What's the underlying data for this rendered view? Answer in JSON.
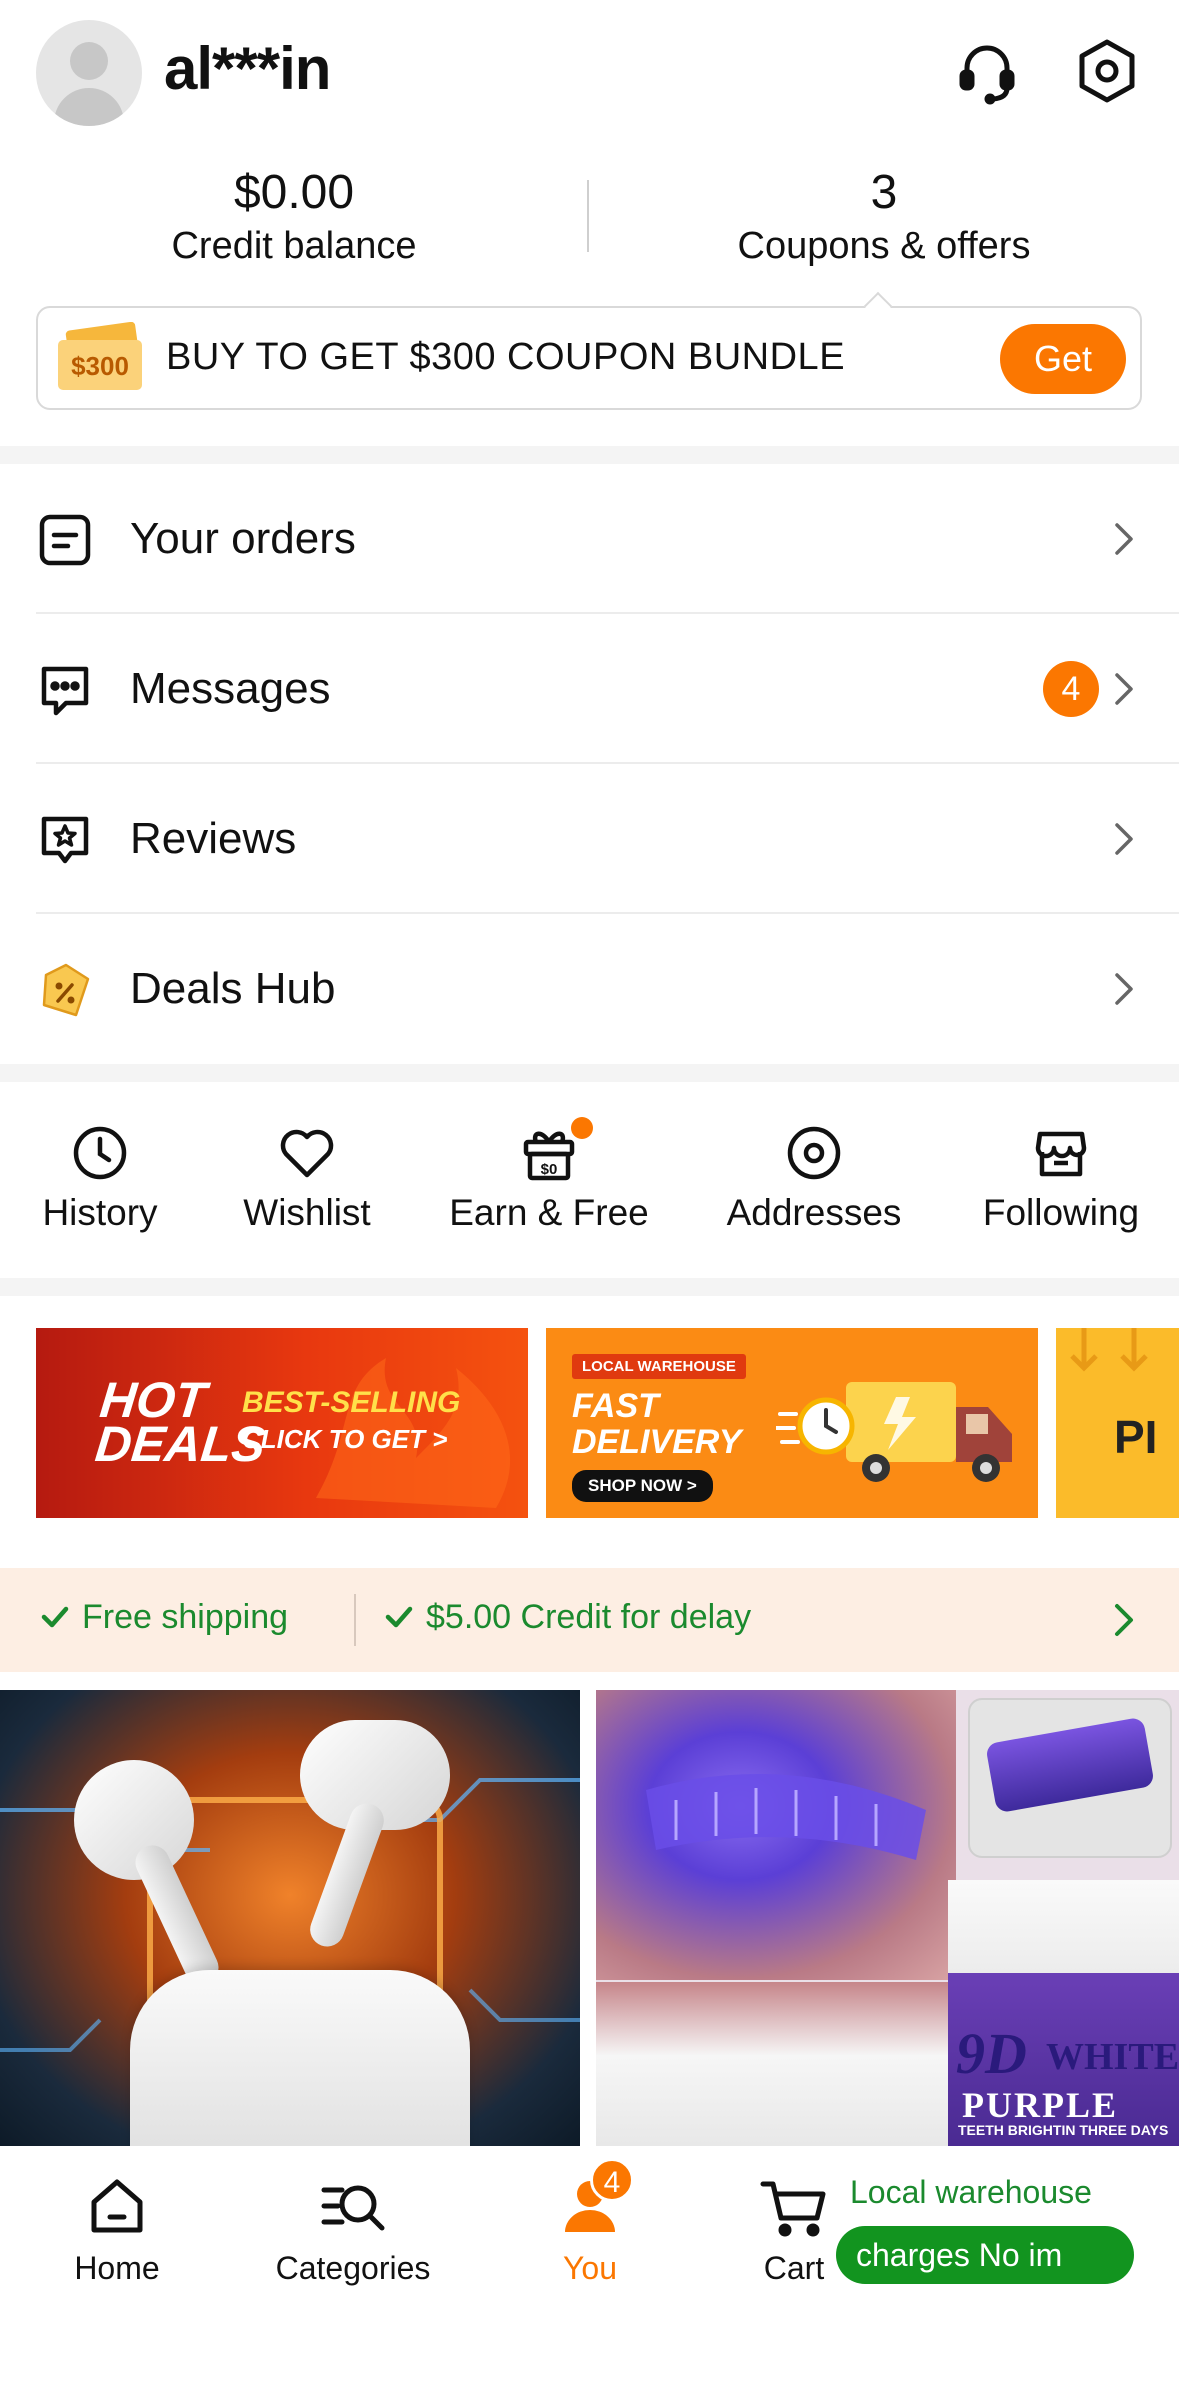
{
  "header": {
    "username": "al***in",
    "icons": [
      "headset-icon",
      "settings-hexagon-icon"
    ]
  },
  "stats": {
    "credit_value": "$0.00",
    "credit_label": "Credit balance",
    "coupons_value": "3",
    "coupons_label": "Coupons & offers"
  },
  "coupon_banner": {
    "badge": "$300",
    "text": "BUY TO GET $300 COUPON BUNDLE",
    "button": "Get"
  },
  "menu": {
    "orders": "Your orders",
    "messages": "Messages",
    "messages_badge": "4",
    "reviews": "Reviews",
    "deals": "Deals Hub"
  },
  "shortcuts": {
    "history": "History",
    "wishlist": "Wishlist",
    "earn": "Earn & Free",
    "addresses": "Addresses",
    "following": "Following"
  },
  "promos": {
    "hot": "HOT",
    "deals": "DEALS",
    "best_selling": "BEST-SELLING",
    "click_to_get": "CLICK TO GET >",
    "local_warehouse": "LOCAL WAREHOUSE",
    "fast": "FAST",
    "delivery": "DELIVERY",
    "shop_now": "SHOP NOW >",
    "third_partial": "PI"
  },
  "shipping": {
    "free_shipping": "Free shipping",
    "credit_delay": "$5.00 Credit for delay"
  },
  "products": {
    "toothpaste_9d": "9D",
    "toothpaste_white": "WHITE",
    "toothpaste_purple": "PURPLE",
    "toothpaste_small": "TEETH BRIGHTIN THREE DAYS"
  },
  "bottom_nav": {
    "home": "Home",
    "categories": "Categories",
    "you": "You",
    "you_badge": "4",
    "cart": "Cart",
    "local_warehouse": "Local warehouse",
    "pill_text": "charges    No im"
  },
  "colors": {
    "accent": "#fb7701",
    "green": "#1b8a2e",
    "pill_green": "#12941f"
  }
}
